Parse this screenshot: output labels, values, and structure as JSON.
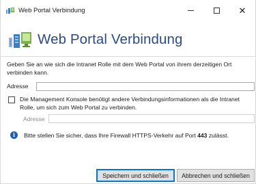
{
  "window": {
    "title": "Web Portal Verbindung"
  },
  "header": {
    "heading": "Web Portal Verbindung"
  },
  "description": "Geben Sie an wie sich die Intranet Rolle mit dem Web Portal von ihrem derzeitigen Ort verbinden kann.",
  "address_field": {
    "label": "Adresse",
    "value": ""
  },
  "alt_connection": {
    "checkbox_label": "Die Management Konsole benötigt andere Verbindungsinformationen als die Intranet Rolle, um sich zum Web Portal zu verbinden.",
    "checked": false,
    "address_label": "Adresse",
    "address_value": ""
  },
  "info": {
    "text_before": "Bitte stellen Sie sicher, dass Ihre Firewall HTTPS-Verkehr auf Port ",
    "port": "443",
    "text_after": " zulässt."
  },
  "buttons": {
    "save": "Speichern und schließen",
    "cancel": "Abbrechen und schließen"
  },
  "colors": {
    "heading": "#2c4a87",
    "info_icon": "#1d5fb0",
    "primary_border": "#0078d7"
  }
}
